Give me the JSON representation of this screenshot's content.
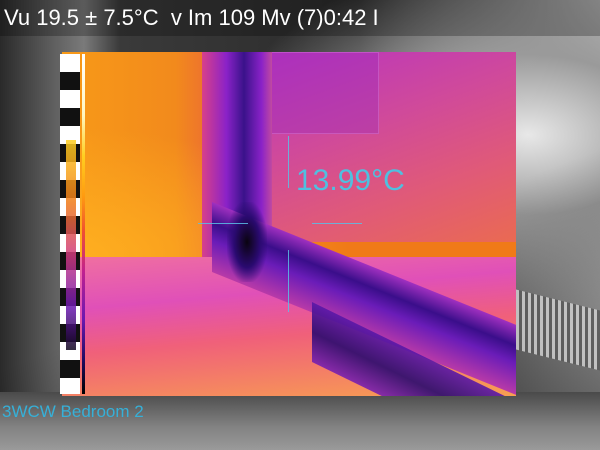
{
  "status_bar": {
    "text": "Vu 19.5 ± 7.5°C  v Im 109 Mv (7)0:42 I"
  },
  "thermal_view": {
    "spot_temperature": "13.99°C",
    "palette": [
      "#ffffff",
      "#ffcf20",
      "#f07a18",
      "#d03a80",
      "#6a18b0",
      "#200a60",
      "#000000"
    ],
    "crosshair_color": "#4fc0e0"
  },
  "caption": {
    "text": "3WCW Bedroom 2"
  }
}
